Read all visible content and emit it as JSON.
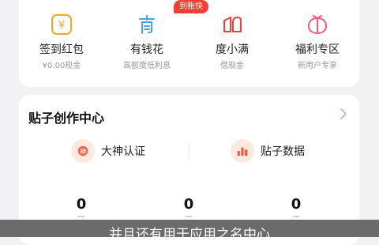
{
  "shortcuts": [
    {
      "icon": "coin-icon",
      "label": "签到红包",
      "sub": "¥0.00现金"
    },
    {
      "icon": "youqianhua-logo-icon",
      "label": "有钱花",
      "sub": "高额度低利息",
      "badge": "到账快"
    },
    {
      "icon": "duxiaoman-logo-icon",
      "label": "度小满",
      "sub": "借现金"
    },
    {
      "icon": "gift-icon",
      "label": "福利专区",
      "sub": "新用户专享"
    }
  ],
  "post_center": {
    "title": "贴子创作中心",
    "items": [
      {
        "icon": "badge-icon",
        "label": "大神认证"
      },
      {
        "icon": "bar-chart-icon",
        "label": "贴子数据"
      }
    ],
    "stats": [
      "0",
      "0",
      "0"
    ]
  },
  "toast": "并且还有用于应用之名中心",
  "colors": {
    "accent": "#ef3e33",
    "icon_orange": "#f5a623",
    "icon_soft": "#fde9df"
  }
}
